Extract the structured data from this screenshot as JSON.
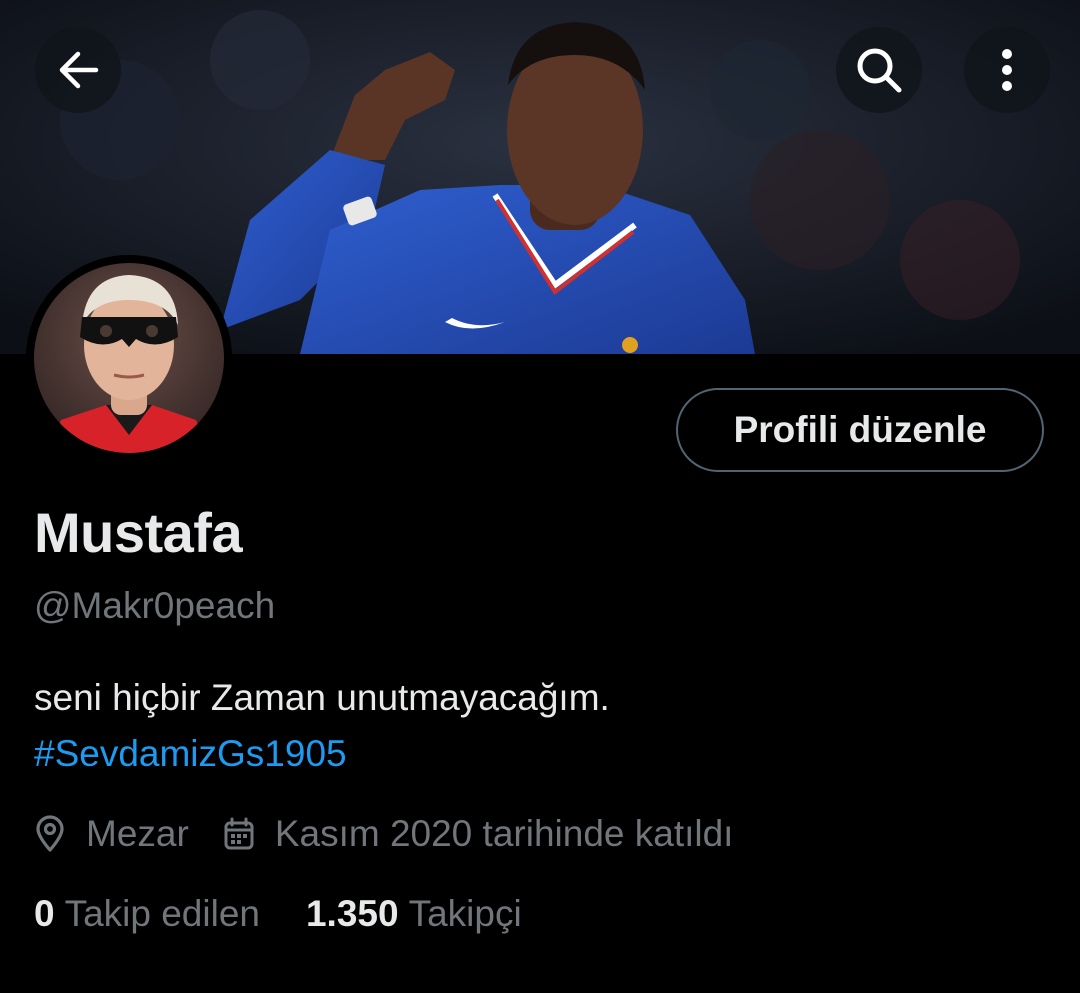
{
  "profile": {
    "name": "Mustafa",
    "handle": "@Makr0peach",
    "bio_text": "seni hiçbir Zaman unutmayacağım.",
    "bio_hashtag": "#SevdamizGs1905",
    "location": "Mezar",
    "joined": "Kasım 2020 tarihinde katıldı",
    "following_count": "0",
    "following_label": "Takip edilen",
    "followers_count": "1.350",
    "followers_label": "Takipçi"
  },
  "actions": {
    "edit_profile_label": "Profili düzenle"
  },
  "icons": {
    "back": "arrow-left-icon",
    "search": "search-icon",
    "more": "more-vertical-icon",
    "location": "location-pin-icon",
    "calendar": "calendar-icon"
  },
  "colors": {
    "background": "#000000",
    "text_primary": "#e7e9ea",
    "text_secondary": "#71767b",
    "link": "#1d9bf0",
    "button_border": "#536471"
  }
}
